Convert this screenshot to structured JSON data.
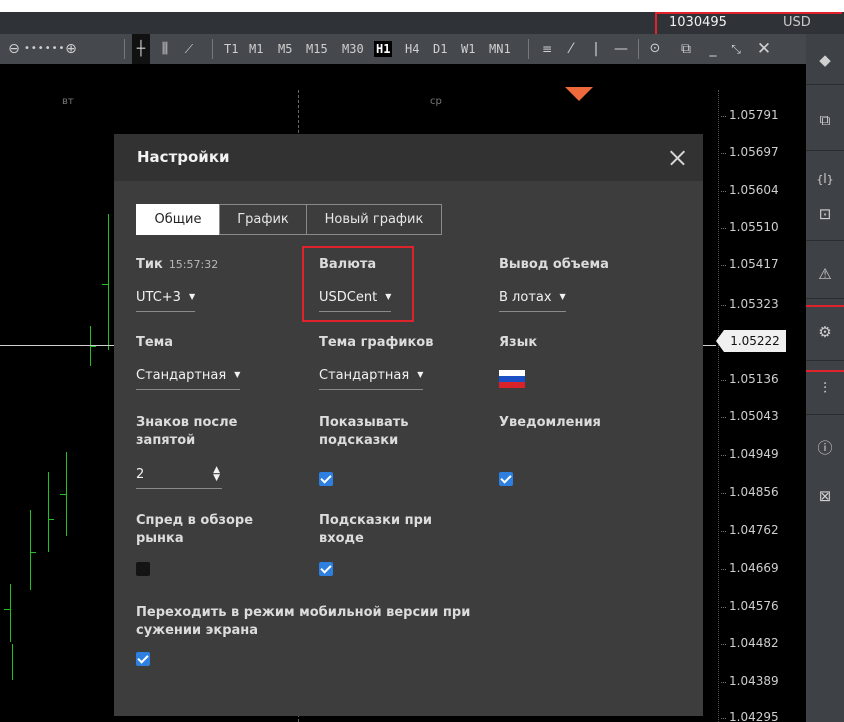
{
  "account": {
    "number": "1030495",
    "currency": "USD"
  },
  "toolbar": {
    "timeframes": [
      "T1",
      "M1",
      "M5",
      "M15",
      "M30",
      "H1",
      "H4",
      "D1",
      "W1",
      "MN1"
    ],
    "active_timeframe": "H1"
  },
  "chart": {
    "day_labels": [
      "вт",
      "ср"
    ],
    "price_labels": [
      "1.05791",
      "1.05697",
      "1.05604",
      "1.05510",
      "1.05417",
      "1.05323",
      "1.05136",
      "1.05043",
      "1.04949",
      "1.04856",
      "1.04762",
      "1.04669",
      "1.04576",
      "1.04482",
      "1.04389",
      "1.04295"
    ],
    "current_price": "1.05222"
  },
  "settings": {
    "title": "Настройки",
    "tabs": [
      "Общие",
      "График",
      "Новый график"
    ],
    "active_tab": "Общие",
    "tick": {
      "label": "Тик",
      "time": "15:57:32",
      "value": "UTC+3"
    },
    "currency": {
      "label": "Валюта",
      "value": "USDCent"
    },
    "volume": {
      "label": "Вывод объема",
      "value": "В лотах"
    },
    "theme": {
      "label": "Тема",
      "value": "Стандартная"
    },
    "chart_theme": {
      "label": "Тема графиков",
      "value": "Стандартная"
    },
    "language": {
      "label": "Язык"
    },
    "digits": {
      "label_line1": "Знаков после",
      "label_line2": "запятой",
      "value": "2"
    },
    "show_hints": {
      "label_line1": "Показывать",
      "label_line2": "подсказки",
      "checked": true
    },
    "notifications": {
      "label": "Уведомления",
      "checked": true
    },
    "spread": {
      "label_line1": "Спред в обзоре",
      "label_line2": "рынка",
      "checked": false
    },
    "login_hints": {
      "label_line1": "Подсказки при",
      "label_line2": "входе",
      "checked": true
    },
    "mobile": {
      "label_line1": "Переходить в режим мобильной версии при",
      "label_line2": "сужении экрана",
      "checked": true
    }
  },
  "colors": {
    "accent": "#2d7fe0",
    "highlight": "#e0222a",
    "candle": "#20c020",
    "marker": "#ee6a3c"
  }
}
